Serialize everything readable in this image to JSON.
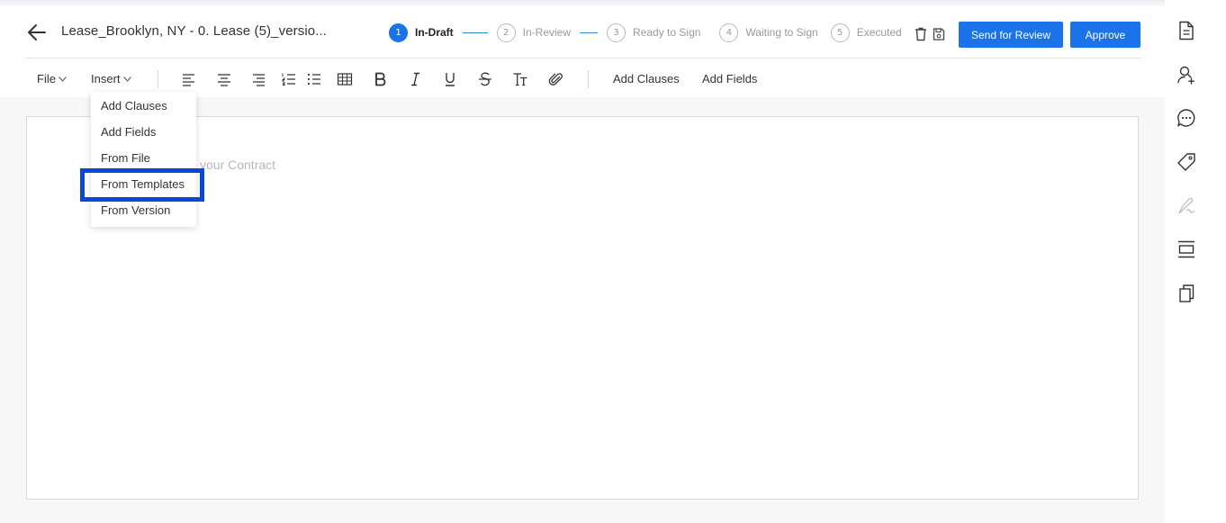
{
  "header": {
    "title": "Lease_Brooklyn, NY - 0. Lease (5)_versio...",
    "steps": [
      {
        "number": "1",
        "label": "In-Draft",
        "active": true
      },
      {
        "number": "2",
        "label": "In-Review",
        "active": false
      },
      {
        "number": "3",
        "label": "Ready to Sign",
        "active": false
      },
      {
        "number": "4",
        "label": "Waiting to Sign",
        "active": false
      },
      {
        "number": "5",
        "label": "Executed",
        "active": false
      }
    ],
    "send_for_review_label": "Send for Review",
    "approve_label": "Approve",
    "accent_color": "#1a73e8"
  },
  "toolbar": {
    "file_label": "File",
    "insert_label": "Insert",
    "add_clauses_label": "Add Clauses",
    "add_fields_label": "Add Fields",
    "formatting_icons": [
      "align-left-icon",
      "align-center-icon",
      "align-right-icon",
      "numbered-list-icon",
      "bullet-list-icon",
      "table-icon",
      "bold-icon",
      "italic-icon",
      "underline-icon",
      "strikethrough-icon",
      "text-size-icon",
      "attachment-icon"
    ]
  },
  "insert_menu": {
    "items": [
      "Add Clauses",
      "Add Fields",
      "From File",
      "From Templates",
      "From Version"
    ],
    "highlighted": "From Templates",
    "highlight_color": "#0a46d8"
  },
  "editor": {
    "placeholder": "your Contract"
  },
  "sidebar": {
    "icons": [
      "document-icon",
      "user-search-icon",
      "comment-icon",
      "tag-icon",
      "signature-icon",
      "layout-icon",
      "copy-icon"
    ]
  }
}
